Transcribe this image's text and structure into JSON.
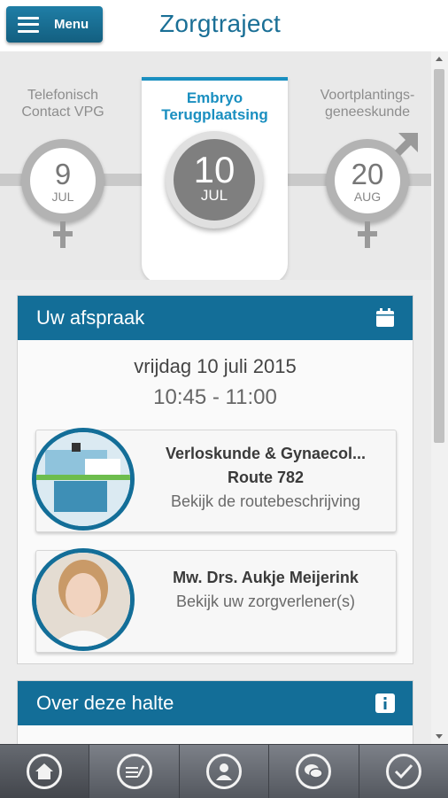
{
  "header": {
    "menu_label": "Menu",
    "title": "Zorgtraject"
  },
  "timeline": {
    "steps": [
      {
        "label": "Telefonisch Contact VPG",
        "day": "9",
        "month": "JUL",
        "symbol": "female-icon"
      },
      {
        "label_line1": "Embryo",
        "label_line2": "Terugplaatsing",
        "day": "10",
        "month": "JUL",
        "active": true
      },
      {
        "label_line1": "Voortplantings-",
        "label_line2": "geneeskunde",
        "day": "20",
        "month": "AUG",
        "symbol": "female-male-icon"
      }
    ]
  },
  "appointment": {
    "heading": "Uw afspraak",
    "date": "vrijdag 10 juli 2015",
    "time": "10:45 - 11:00",
    "route": {
      "department": "Verloskunde & Gynaecol...",
      "route": "Route 782",
      "link": "Bekijk de routebeschrijving"
    },
    "provider": {
      "name": "Mw. Drs. Aukje Meijerink",
      "link": "Bekijk uw zorgverlener(s)"
    }
  },
  "about": {
    "heading": "Over deze halte"
  },
  "colors": {
    "brand": "#136e98",
    "accent": "#1a8fc0",
    "nav": "#5c6067"
  },
  "nav": [
    {
      "icon": "home-icon",
      "active": true
    },
    {
      "icon": "edit-note-icon"
    },
    {
      "icon": "person-icon"
    },
    {
      "icon": "chat-icon"
    },
    {
      "icon": "checkmark-icon"
    }
  ]
}
